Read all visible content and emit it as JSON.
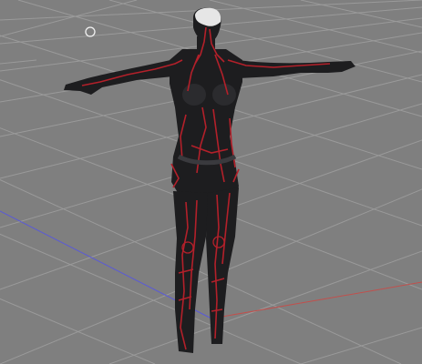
{
  "viewport": {
    "background_color": "#7f7f7f",
    "grid_color": "#9a9a9a",
    "x_axis_color": "#c0504d",
    "z_axis_color": "#5a5ad6",
    "y_axis_color": "#4ab04a"
  },
  "model": {
    "body_color": "#1d1d1f",
    "vein_color": "#b3202a",
    "mask_color": "#e6e6e6"
  },
  "cursor": {
    "icon": "circle-cursor-icon"
  }
}
